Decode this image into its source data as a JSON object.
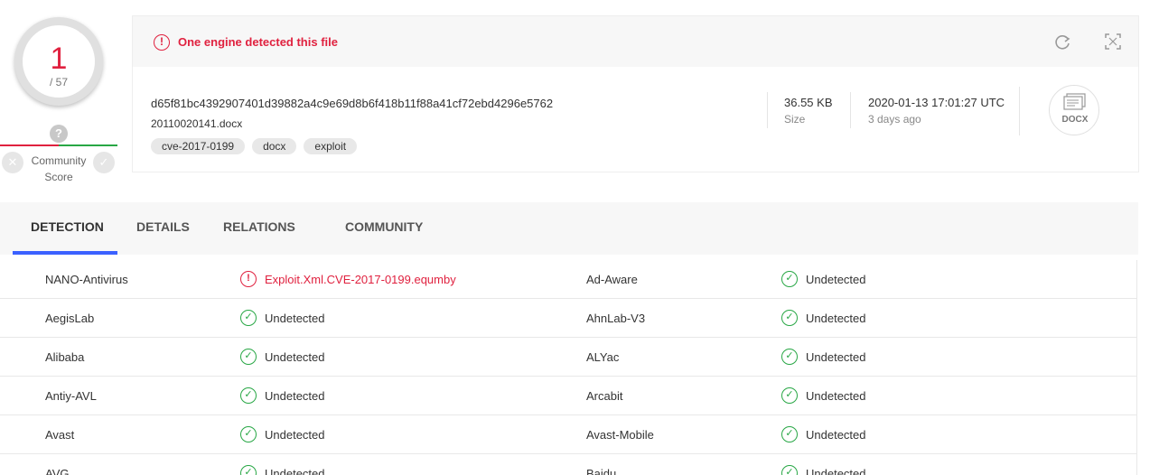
{
  "score": {
    "detected": "1",
    "total": "/ 57",
    "question_mark": "?",
    "community_label_line1": "Community",
    "community_label_line2": "Score",
    "x_glyph": "✕",
    "check_glyph": "✓"
  },
  "header": {
    "alert_glyph": "!",
    "alert_text": "One engine detected this file",
    "hash": "d65f81bc4392907401d39882a4c9e69d8b6f418b11f88a41cf72ebd4296e5762",
    "filename": "20110020141.docx",
    "tags": [
      "cve-2017-0199",
      "docx",
      "exploit"
    ],
    "size_value": "36.55 KB",
    "size_label": "Size",
    "date_value": "2020-01-13 17:01:27 UTC",
    "date_ago": "3 days ago",
    "file_type_badge": "DOCX",
    "icons": [
      "alert-icon",
      "reanalyze-icon",
      "expand-icon",
      "docx-file-icon"
    ]
  },
  "tabs": [
    "DETECTION",
    "DETAILS",
    "RELATIONS",
    "COMMUNITY"
  ],
  "colors": {
    "danger": "#e0213f",
    "success": "#28a745",
    "tab_active": "#3b61ff"
  },
  "detections": [
    {
      "engine_a": "NANO-Antivirus",
      "result_a": "Exploit.Xml.CVE-2017-0199.equmby",
      "status_a": "malicious",
      "engine_b": "Ad-Aware",
      "result_b": "Undetected",
      "status_b": "clean"
    },
    {
      "engine_a": "AegisLab",
      "result_a": "Undetected",
      "status_a": "clean",
      "engine_b": "AhnLab-V3",
      "result_b": "Undetected",
      "status_b": "clean"
    },
    {
      "engine_a": "Alibaba",
      "result_a": "Undetected",
      "status_a": "clean",
      "engine_b": "ALYac",
      "result_b": "Undetected",
      "status_b": "clean"
    },
    {
      "engine_a": "Antiy-AVL",
      "result_a": "Undetected",
      "status_a": "clean",
      "engine_b": "Arcabit",
      "result_b": "Undetected",
      "status_b": "clean"
    },
    {
      "engine_a": "Avast",
      "result_a": "Undetected",
      "status_a": "clean",
      "engine_b": "Avast-Mobile",
      "result_b": "Undetected",
      "status_b": "clean"
    },
    {
      "engine_a": "AVG",
      "result_a": "Undetected",
      "status_a": "clean",
      "engine_b": "Baidu",
      "result_b": "Undetected",
      "status_b": "clean"
    }
  ]
}
